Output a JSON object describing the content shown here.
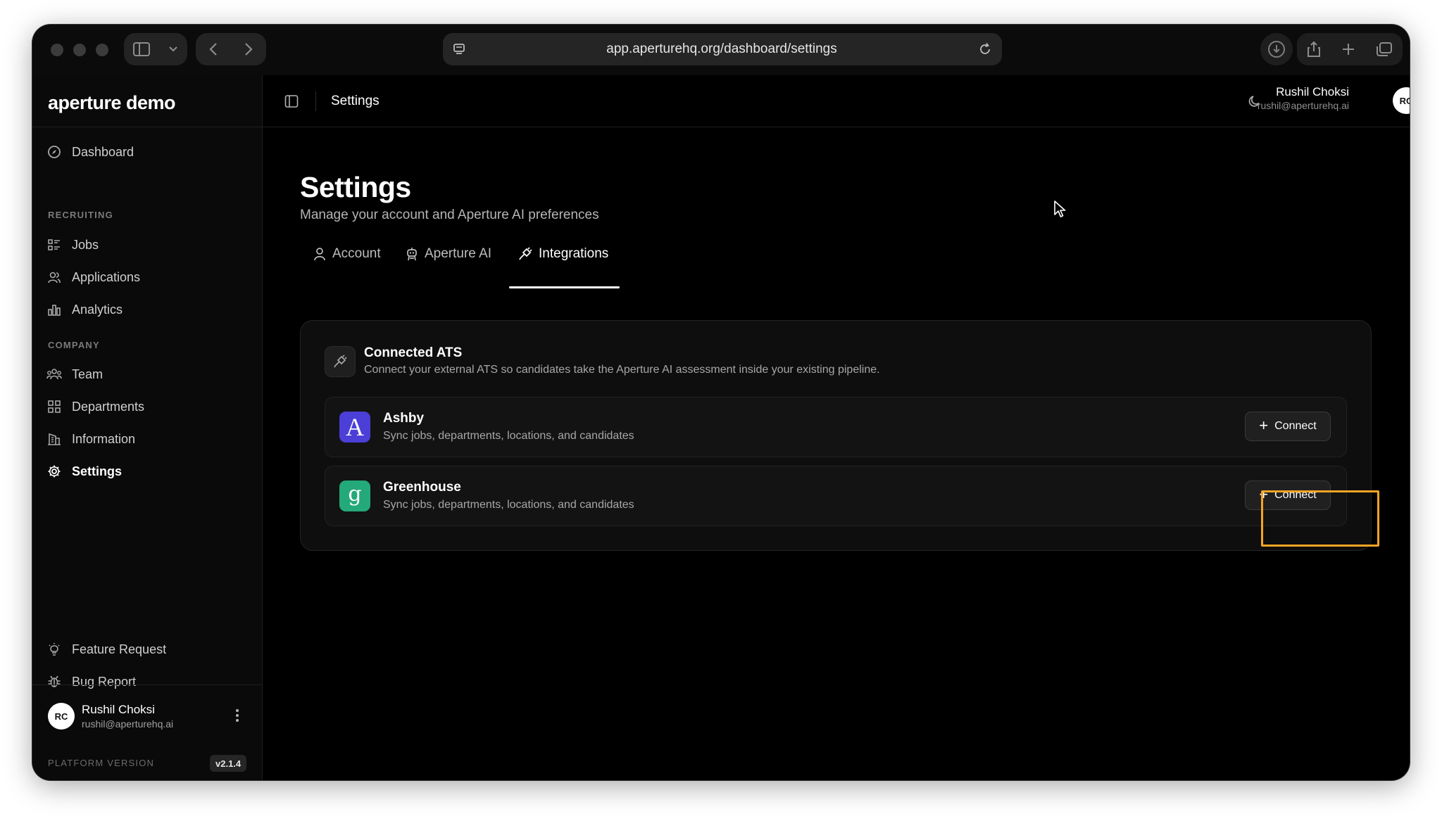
{
  "browser": {
    "url": "app.aperturehq.org/dashboard/settings"
  },
  "sidebar": {
    "brand": "aperture demo",
    "items": {
      "dashboard": "Dashboard",
      "jobs": "Jobs",
      "applications": "Applications",
      "analytics": "Analytics",
      "team": "Team",
      "departments": "Departments",
      "information": "Information",
      "settings": "Settings",
      "feature_request": "Feature Request",
      "bug_report": "Bug Report"
    },
    "sections": {
      "recruiting": "RECRUITING",
      "company": "COMPANY"
    },
    "user": {
      "initials": "RC",
      "name": "Rushil Choksi",
      "email": "rushil@aperturehq.ai"
    },
    "platform_label": "PLATFORM VERSION",
    "version": "v2.1.4"
  },
  "topbar": {
    "title": "Settings",
    "user": {
      "name": "Rushil Choksi",
      "email": "rushil@aperturehq.ai",
      "initials": "RC"
    }
  },
  "page": {
    "title": "Settings",
    "subtitle": "Manage your account and Aperture AI preferences",
    "tabs": {
      "account": "Account",
      "aperture_ai": "Aperture AI",
      "integrations": "Integrations"
    },
    "active_tab": "Integrations"
  },
  "card": {
    "title": "Connected ATS",
    "description": "Connect your external ATS so candidates take the Aperture AI assessment inside your existing pipeline.",
    "integrations": [
      {
        "name": "Ashby",
        "description": "Sync jobs, departments, locations, and candidates",
        "logo_letter": "A",
        "logo_color": "#4b3fd8",
        "button": "Connect"
      },
      {
        "name": "Greenhouse",
        "description": "Sync jobs, departments, locations, and candidates",
        "logo_letter": "g",
        "logo_color": "#24a97a",
        "button": "Connect"
      }
    ]
  },
  "colors": {
    "highlight": "#f5a524",
    "background": "#000000"
  }
}
